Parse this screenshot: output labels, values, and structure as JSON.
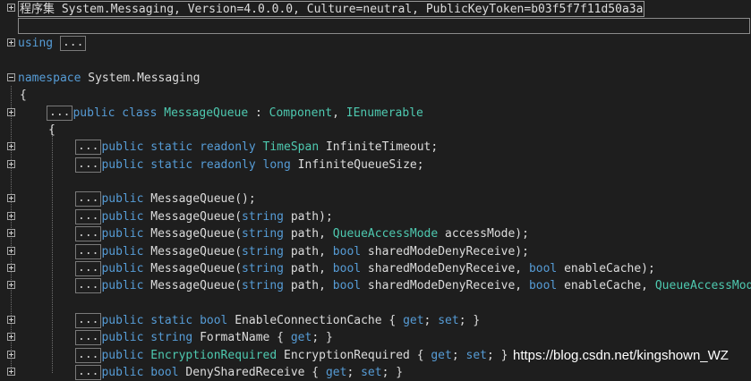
{
  "assembly_header": "程序集 System.Messaging, Version=4.0.0.0, Culture=neutral, PublicKeyToken=b03f5f7f11d50a3a",
  "ellipsis": "...",
  "tokens": {
    "using": "using",
    "namespace": "namespace",
    "namespace_name": " System.Messaging",
    "open_brace": "{",
    "public": "public",
    "class": " class ",
    "static": " static",
    "readonly": " readonly ",
    "string": "string",
    "bool": "bool",
    "long": "long",
    "class_name": "MessageQueue",
    "colon": " : ",
    "component": "Component",
    "comma_space": ", ",
    "ienumerable": "IEnumerable",
    "timespan": "TimeSpan",
    "queue_access_mode": "QueueAccessMode",
    "queue_access_mode_cut": "QueueAccessMod",
    "encryption_required": "EncryptionRequired",
    "get": "get",
    "set": "set"
  },
  "texts": {
    "infinite_timeout": " InfiniteTimeout;",
    "infinite_queue_size": " InfiniteQueueSize;",
    "ctor_empty": " MessageQueue();",
    "ctor_open": " MessageQueue(",
    "path_close": " path);",
    "path": " path, ",
    "access_mode_close": " accessMode);",
    "deny_close": " sharedModeDenyReceive);",
    "deny_comma": " sharedModeDenyReceive, ",
    "enable_cache_close": " enableCache);",
    "enable_cache_comma": " enableCache, ",
    "enable_connection_cache": " EnableConnectionCache { ",
    "format_name": " FormatName { ",
    "deny_shared_receive": " DenySharedReceive { ",
    "encryption_required_space": " EncryptionRequired { ",
    "semi_space": "; ",
    "semi_close": "; }",
    "close_brace": "}"
  },
  "watermark": "https://blog.csdn.net/kingshown_WZ",
  "colors": {
    "background": "#1e1e1e",
    "keyword": "#569cd6",
    "type": "#4ec9b0",
    "text": "#dcdcdc"
  }
}
